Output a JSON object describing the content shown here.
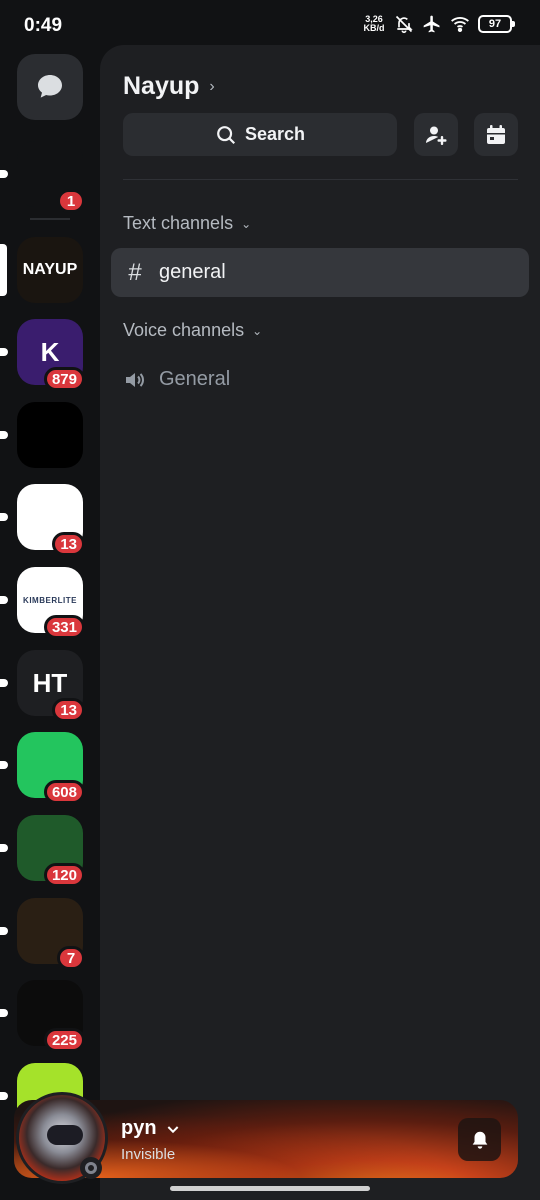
{
  "status_bar": {
    "time": "0:49",
    "net_speed_value": "3,26",
    "net_speed_unit": "KB/d",
    "battery": "97"
  },
  "server": {
    "name": "Nayup"
  },
  "header": {
    "search_label": "Search"
  },
  "categories": [
    {
      "name": "Text channels",
      "channels": [
        {
          "name": "general",
          "type": "text",
          "selected": true
        }
      ]
    },
    {
      "name": "Voice channels",
      "channels": [
        {
          "name": "General",
          "type": "voice",
          "selected": false
        }
      ]
    }
  ],
  "rail": {
    "servers": [
      {
        "name": "server-1",
        "badge": "1",
        "color": "#111214"
      },
      {
        "name": "server-nayup",
        "badge": "",
        "color": "#1a1510",
        "label": "NAYUP"
      },
      {
        "name": "server-2",
        "badge": "879",
        "color": "#3a1d6e",
        "label": "K"
      },
      {
        "name": "server-3",
        "badge": "",
        "color": "#000000"
      },
      {
        "name": "server-4",
        "badge": "13",
        "color": "#ffffff"
      },
      {
        "name": "server-kimberlite",
        "badge": "331",
        "color": "#ffffff",
        "label": "KIMBERLITE"
      },
      {
        "name": "server-ht",
        "badge": "13",
        "color": "#1e1f22",
        "label": "HT"
      },
      {
        "name": "server-5",
        "badge": "608",
        "color": "#23c55e"
      },
      {
        "name": "server-6",
        "badge": "120",
        "color": "#1f5a2a"
      },
      {
        "name": "server-7",
        "badge": "7",
        "color": "#2a1f14"
      },
      {
        "name": "server-8",
        "badge": "225",
        "color": "#0c0c0c"
      },
      {
        "name": "server-9",
        "badge": "",
        "color": "#a5e22a"
      }
    ]
  },
  "user": {
    "name": "pyn",
    "status": "Invisible"
  }
}
